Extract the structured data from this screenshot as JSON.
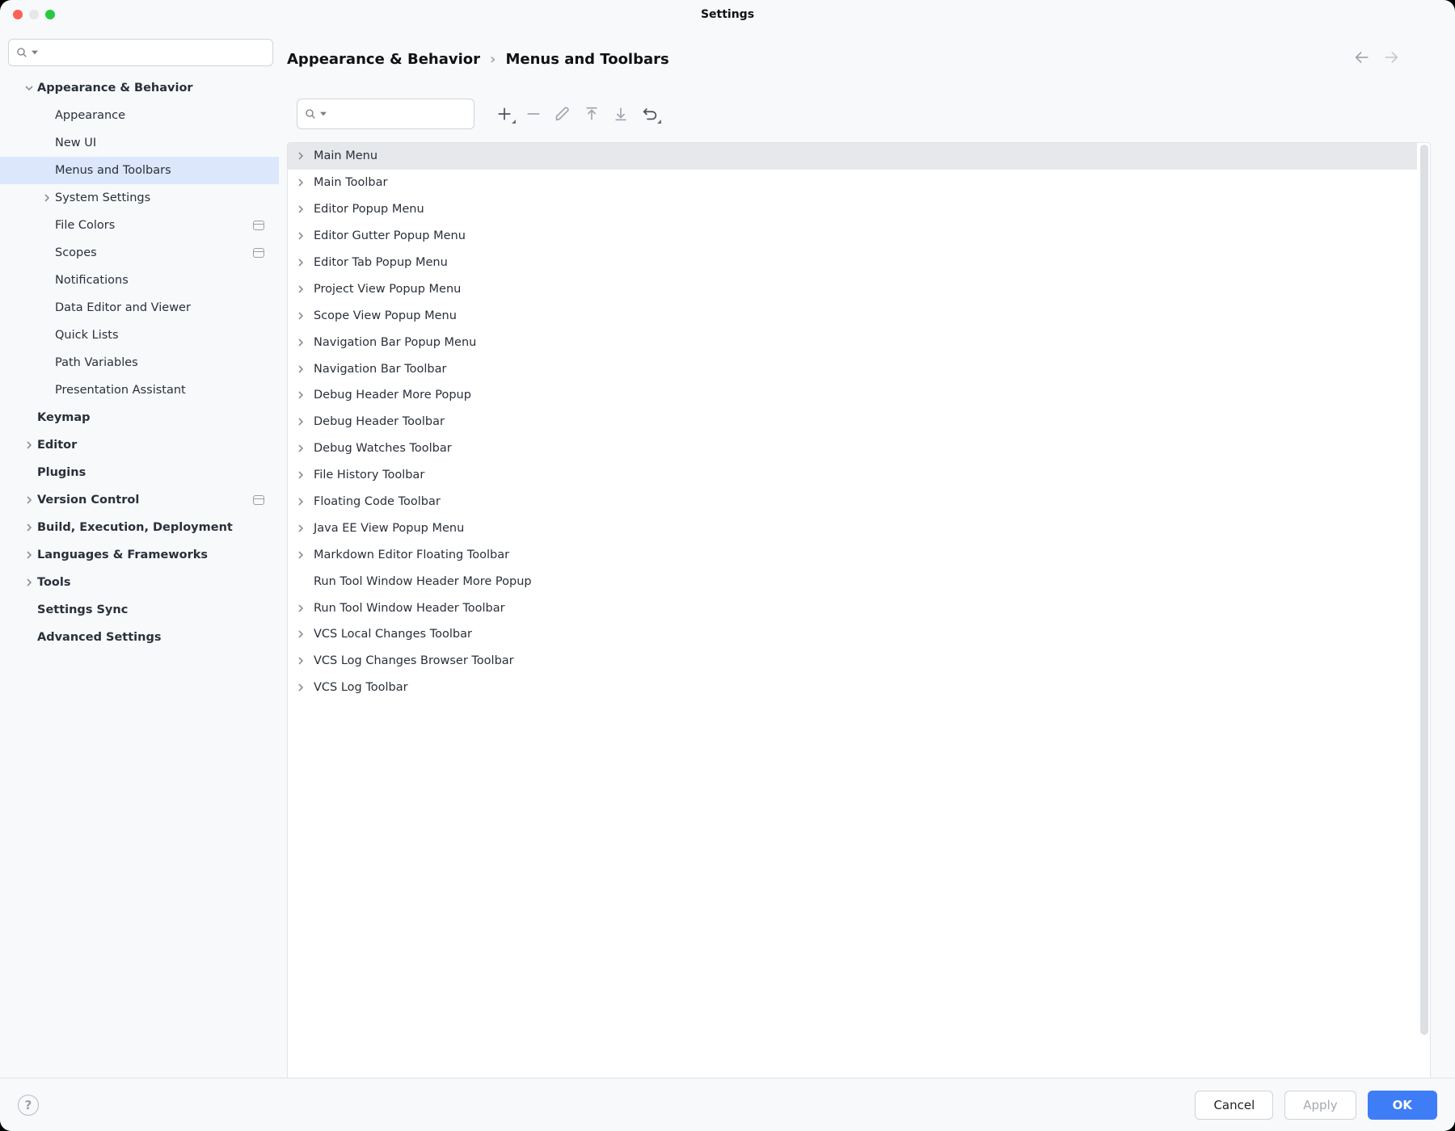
{
  "title": "Settings",
  "breadcrumb": {
    "root": "Appearance & Behavior",
    "sep": "›",
    "leaf": "Menus and Toolbars"
  },
  "sidebar": {
    "items": [
      {
        "label": "Appearance & Behavior",
        "indent": 48,
        "bold": true,
        "chevron": "down",
        "selected": false,
        "badge": false
      },
      {
        "label": "Appearance",
        "indent": 70,
        "bold": false,
        "chevron": "",
        "selected": false,
        "badge": false
      },
      {
        "label": "New UI",
        "indent": 70,
        "bold": false,
        "chevron": "",
        "selected": false,
        "badge": false
      },
      {
        "label": "Menus and Toolbars",
        "indent": 70,
        "bold": false,
        "chevron": "",
        "selected": true,
        "badge": false
      },
      {
        "label": "System Settings",
        "indent": 70,
        "bold": false,
        "chevron": "right",
        "selected": false,
        "badge": false
      },
      {
        "label": "File Colors",
        "indent": 70,
        "bold": false,
        "chevron": "",
        "selected": false,
        "badge": true
      },
      {
        "label": "Scopes",
        "indent": 70,
        "bold": false,
        "chevron": "",
        "selected": false,
        "badge": true
      },
      {
        "label": "Notifications",
        "indent": 70,
        "bold": false,
        "chevron": "",
        "selected": false,
        "badge": false
      },
      {
        "label": "Data Editor and Viewer",
        "indent": 70,
        "bold": false,
        "chevron": "",
        "selected": false,
        "badge": false
      },
      {
        "label": "Quick Lists",
        "indent": 70,
        "bold": false,
        "chevron": "",
        "selected": false,
        "badge": false
      },
      {
        "label": "Path Variables",
        "indent": 70,
        "bold": false,
        "chevron": "",
        "selected": false,
        "badge": false
      },
      {
        "label": "Presentation Assistant",
        "indent": 70,
        "bold": false,
        "chevron": "",
        "selected": false,
        "badge": false
      },
      {
        "label": "Keymap",
        "indent": 48,
        "bold": true,
        "chevron": "",
        "selected": false,
        "badge": false
      },
      {
        "label": "Editor",
        "indent": 48,
        "bold": true,
        "chevron": "right",
        "selected": false,
        "badge": false
      },
      {
        "label": "Plugins",
        "indent": 48,
        "bold": true,
        "chevron": "",
        "selected": false,
        "badge": false
      },
      {
        "label": "Version Control",
        "indent": 48,
        "bold": true,
        "chevron": "right",
        "selected": false,
        "badge": true
      },
      {
        "label": "Build, Execution, Deployment",
        "indent": 48,
        "bold": true,
        "chevron": "right",
        "selected": false,
        "badge": false
      },
      {
        "label": "Languages & Frameworks",
        "indent": 48,
        "bold": true,
        "chevron": "right",
        "selected": false,
        "badge": false
      },
      {
        "label": "Tools",
        "indent": 48,
        "bold": true,
        "chevron": "right",
        "selected": false,
        "badge": false
      },
      {
        "label": "Settings Sync",
        "indent": 48,
        "bold": true,
        "chevron": "",
        "selected": false,
        "badge": false
      },
      {
        "label": "Advanced Settings",
        "indent": 48,
        "bold": true,
        "chevron": "",
        "selected": false,
        "badge": false
      }
    ]
  },
  "tree": {
    "items": [
      {
        "label": "Main Menu",
        "chevron": true,
        "selected": true
      },
      {
        "label": "Main Toolbar",
        "chevron": true,
        "selected": false
      },
      {
        "label": "Editor Popup Menu",
        "chevron": true,
        "selected": false
      },
      {
        "label": "Editor Gutter Popup Menu",
        "chevron": true,
        "selected": false
      },
      {
        "label": "Editor Tab Popup Menu",
        "chevron": true,
        "selected": false
      },
      {
        "label": "Project View Popup Menu",
        "chevron": true,
        "selected": false
      },
      {
        "label": "Scope View Popup Menu",
        "chevron": true,
        "selected": false
      },
      {
        "label": "Navigation Bar Popup Menu",
        "chevron": true,
        "selected": false
      },
      {
        "label": "Navigation Bar Toolbar",
        "chevron": true,
        "selected": false
      },
      {
        "label": "Debug Header More Popup",
        "chevron": true,
        "selected": false
      },
      {
        "label": "Debug Header Toolbar",
        "chevron": true,
        "selected": false
      },
      {
        "label": "Debug Watches Toolbar",
        "chevron": true,
        "selected": false
      },
      {
        "label": "File History Toolbar",
        "chevron": true,
        "selected": false
      },
      {
        "label": "Floating Code Toolbar",
        "chevron": true,
        "selected": false
      },
      {
        "label": "Java EE View Popup Menu",
        "chevron": true,
        "selected": false
      },
      {
        "label": "Markdown Editor Floating Toolbar",
        "chevron": true,
        "selected": false
      },
      {
        "label": "Run Tool Window Header More Popup",
        "chevron": false,
        "selected": false
      },
      {
        "label": "Run Tool Window Header Toolbar",
        "chevron": true,
        "selected": false
      },
      {
        "label": "VCS Local Changes Toolbar",
        "chevron": true,
        "selected": false
      },
      {
        "label": "VCS Log Changes Browser Toolbar",
        "chevron": true,
        "selected": false
      },
      {
        "label": "VCS Log Toolbar",
        "chevron": true,
        "selected": false
      }
    ]
  },
  "buttons": {
    "cancel": "Cancel",
    "apply": "Apply",
    "ok": "OK"
  }
}
